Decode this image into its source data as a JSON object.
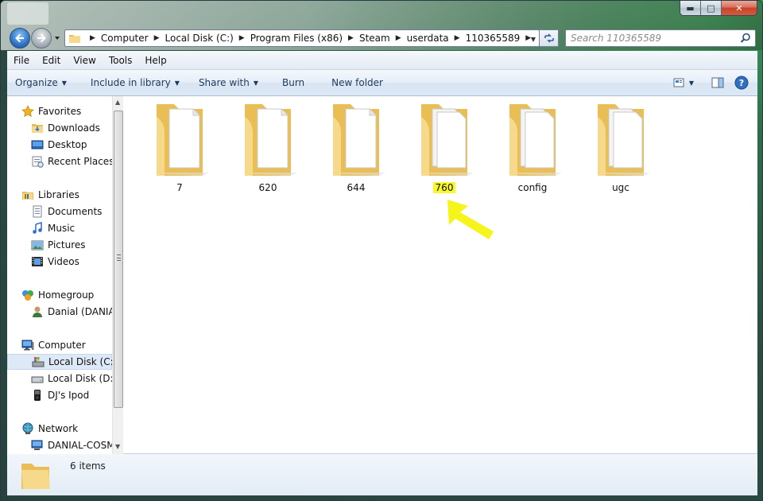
{
  "window": {
    "caption_buttons": {
      "minimize": "▬",
      "maximize": "□",
      "close": "✕"
    }
  },
  "address": {
    "crumbs": [
      "Computer",
      "Local Disk (C:)",
      "Program Files (x86)",
      "Steam",
      "userdata",
      "110365589"
    ],
    "search_placeholder": "Search 110365589"
  },
  "menu": [
    "File",
    "Edit",
    "View",
    "Tools",
    "Help"
  ],
  "commands": {
    "organize": "Organize",
    "include_in_library": "Include in library",
    "share_with": "Share with",
    "burn": "Burn",
    "new_folder": "New folder"
  },
  "nav_pane": {
    "favorites": {
      "label": "Favorites",
      "items": [
        "Downloads",
        "Desktop",
        "Recent Places"
      ]
    },
    "libraries": {
      "label": "Libraries",
      "items": [
        "Documents",
        "Music",
        "Pictures",
        "Videos"
      ]
    },
    "homegroup": {
      "label": "Homegroup",
      "items": [
        "Danial (DANIAL"
      ]
    },
    "computer": {
      "label": "Computer",
      "items": [
        "Local Disk (C:)",
        "Local Disk (D:)",
        "DJ's Ipod"
      ]
    },
    "network": {
      "label": "Network",
      "items": [
        "DANIAL-COSM"
      ]
    }
  },
  "files": [
    {
      "name": "7",
      "highlighted": false
    },
    {
      "name": "620",
      "highlighted": false
    },
    {
      "name": "644",
      "highlighted": false
    },
    {
      "name": "760",
      "highlighted": true
    },
    {
      "name": "config",
      "highlighted": false
    },
    {
      "name": "ugc",
      "highlighted": false
    }
  ],
  "details": {
    "count_text": "6 items"
  },
  "colors": {
    "highlight": "#f7f729",
    "annotation_arrow": "#f5f51c",
    "folder_front": "#f6d98a",
    "folder_back": "#e9bf55"
  }
}
